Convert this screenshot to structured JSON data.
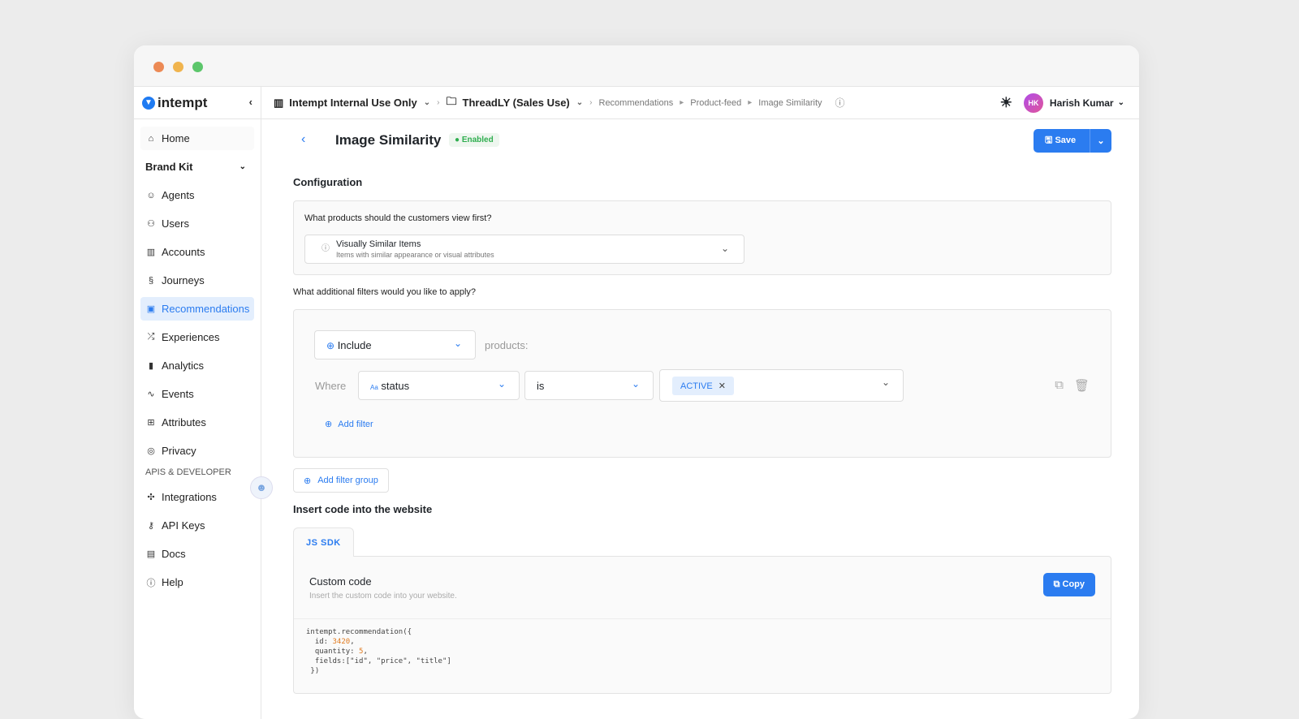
{
  "sidebar": {
    "brand": "intempt",
    "items": [
      {
        "label": "Home",
        "icon": "home-icon"
      },
      {
        "label": "Brand Kit",
        "icon": ""
      },
      {
        "label": "Agents",
        "icon": "robot-icon"
      },
      {
        "label": "Users",
        "icon": "users-icon"
      },
      {
        "label": "Accounts",
        "icon": "building-icon"
      },
      {
        "label": "Journeys",
        "icon": "route-icon"
      },
      {
        "label": "Recommendations",
        "icon": "recommendation-icon"
      },
      {
        "label": "Experiences",
        "icon": "shuffle-icon"
      },
      {
        "label": "Analytics",
        "icon": "chart-icon"
      },
      {
        "label": "Events",
        "icon": "pulse-icon"
      },
      {
        "label": "Attributes",
        "icon": "table-icon"
      },
      {
        "label": "Privacy",
        "icon": "eye-icon"
      }
    ],
    "section": "APIS & DEVELOPER",
    "dev_items": [
      {
        "label": "Integrations"
      },
      {
        "label": "API Keys"
      },
      {
        "label": "Docs"
      },
      {
        "label": "Help"
      }
    ]
  },
  "breadcrumb": {
    "org": "Intempt Internal Use Only",
    "project": "ThreadLY (Sales Use)",
    "path": [
      "Recommendations",
      "Product-feed",
      "Image Similarity"
    ]
  },
  "user": {
    "initials": "HK",
    "name": "Harish Kumar"
  },
  "page": {
    "title": "Image Similarity",
    "status": "Enabled",
    "save": "Save"
  },
  "config": {
    "heading": "Configuration",
    "question": "What products should the customers view first?",
    "selected": "Visually Similar Items",
    "selected_desc": "Items with similar appearance or visual attributes"
  },
  "filters": {
    "question": "What additional filters would you like to apply?",
    "mode": "Include",
    "suffix": "products:",
    "where": "Where",
    "attr_tag": "Aa",
    "attribute": "status",
    "operator": "is",
    "value": "ACTIVE",
    "add_filter": "Add filter",
    "add_group": "Add filter group"
  },
  "code": {
    "heading": "Insert code into the website",
    "tab": "JS SDK",
    "title": "Custom code",
    "desc": "Insert the custom code into your website.",
    "copy": "Copy",
    "l1": "intempt.recommendation({",
    "l2a": "  id: ",
    "l2b": "3420",
    "l2c": ",",
    "l3a": "  quantity: ",
    "l3b": "5",
    "l3c": ",",
    "l4": "  fields:[\"id\", \"price\", \"title\"]",
    "l5": " })"
  },
  "colors": {
    "accent": "#2b7cf0",
    "enabled": "#2fae4f"
  }
}
